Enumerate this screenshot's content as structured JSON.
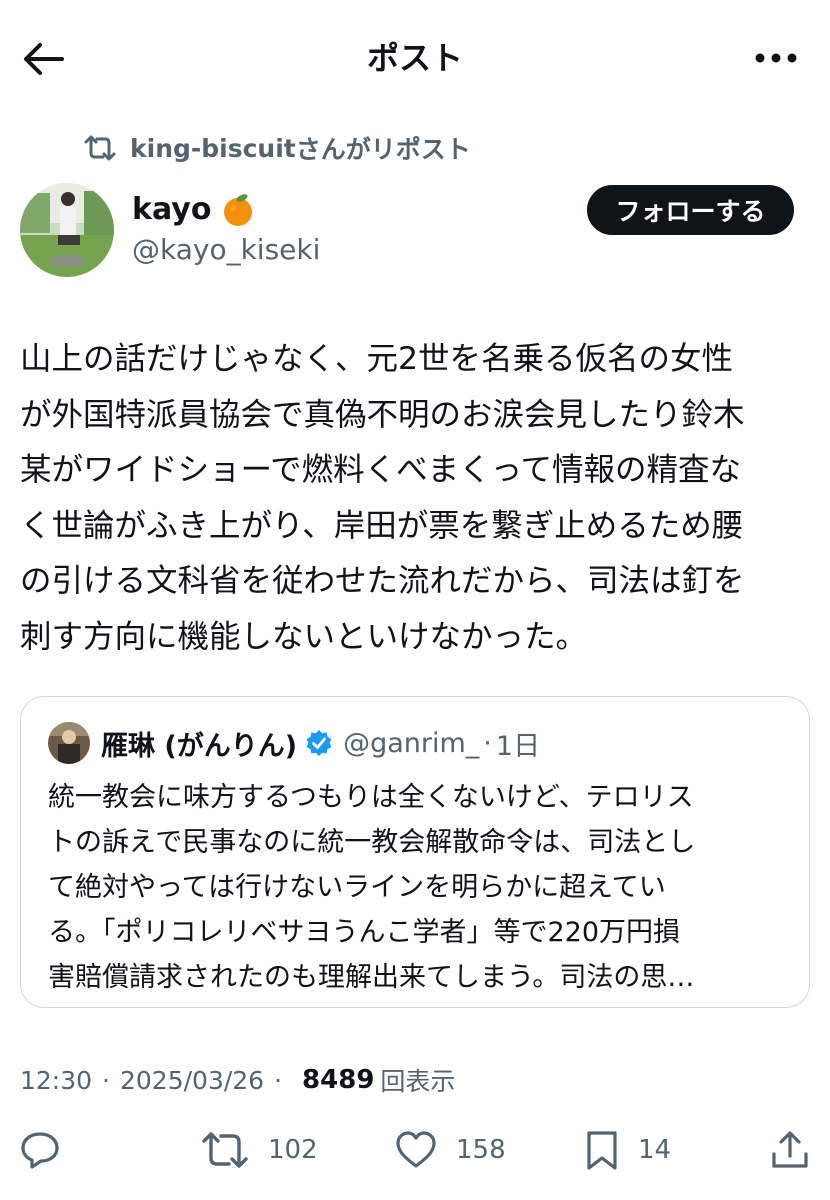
{
  "header": {
    "title": "ポスト",
    "back_icon": "arrow-left-icon",
    "more_icon": "more-dots-icon"
  },
  "repost": {
    "user": "king-biscuit",
    "suffix": "さんがリポスト",
    "icon": "repost-icon"
  },
  "author": {
    "name": "kayo",
    "emoji_icon": "orange-icon",
    "handle": "@kayo_kiseki",
    "follow_label": "フォローする"
  },
  "tweet": {
    "lines": [
      "山上の話だけじゃなく、元2世を名乗る仮名の女性",
      "が外国特派員協会で真偽不明のお涙会見したり鈴木",
      "某がワイドショーで燃料くべまくって情報の精査な",
      "く世論がふき上がり、岸田が票を繋ぎ止めるため腰",
      "の引ける文科省を従わせた流れだから、司法は釘を",
      "刺す方向に機能しないといけなかった。"
    ]
  },
  "quote": {
    "name": "雁琳 (がんりん)",
    "verified_icon": "verified-badge-icon",
    "handle": "@ganrim_",
    "dot": "·",
    "time": "1日",
    "lines": [
      "統一教会に味方するつもりは全くないけど、テロリス",
      "トの訴えで民事なのに統一教会解散命令は、司法とし",
      "て絶対やっては行けないラインを明らかに超えてい",
      "る。「ポリコレリベサヨうんこ学者」等で220万円損",
      "害賠償請求されたのも理解出来てしまう。司法の思…"
    ]
  },
  "meta": {
    "time": "12:30",
    "sep": "·",
    "date": "2025/03/26",
    "views": "8489",
    "views_label": "回表示"
  },
  "actions": {
    "reply_icon": "reply-icon",
    "repost_icon": "repost-icon",
    "repost_count": "102",
    "like_icon": "heart-icon",
    "like_count": "158",
    "bookmark_icon": "bookmark-icon",
    "bookmark_count": "14",
    "share_icon": "share-icon"
  },
  "colors": {
    "text": "#0f1419",
    "secondary": "#536471",
    "border": "#cfd9de",
    "verified": "#1d9bf0",
    "orange": "#f4900c"
  }
}
